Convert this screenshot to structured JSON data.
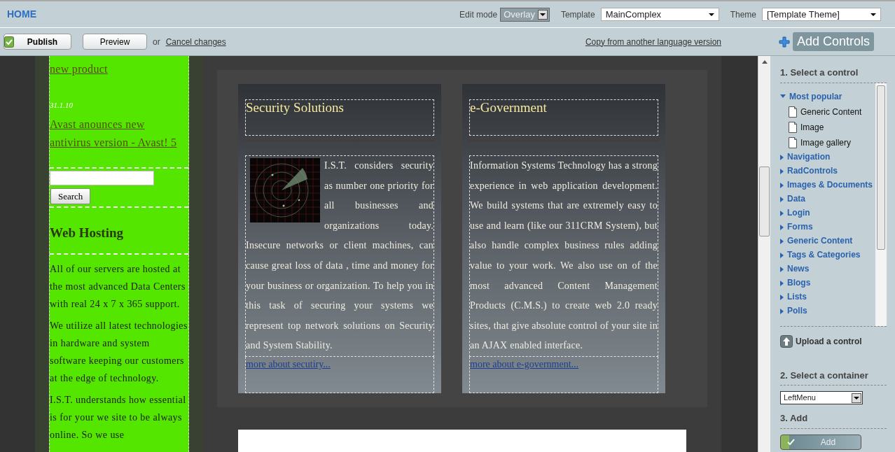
{
  "header": {
    "home": "HOME",
    "edit_mode": {
      "label": "Edit mode",
      "value": "Overlay"
    },
    "template": {
      "label": "Template",
      "value": "MainComplex"
    },
    "theme": {
      "label": "Theme",
      "value": "[Template Theme]"
    }
  },
  "toolbar": {
    "publish": "Publish",
    "preview": "Preview",
    "or": "or",
    "cancel": "Cancel changes",
    "copy": "Copy from another language version",
    "add_controls": "Add Controls"
  },
  "left_column": {
    "link_1": "new product",
    "date": "31.1.10",
    "link_2": "Avast anounces new antivirus version - Avast! 5",
    "search_button": "Search",
    "heading": "Web Hosting",
    "paragraphs": [
      "All of our servers are hosted at the most advanced Data Centers with real 24 x 7 x 365 support.",
      "We utilize all latest technologies in hardware and system software keeping our customers at the edge of technology.",
      "I.S.T. understands how essential is for your we site to be always online. So we use"
    ]
  },
  "cards": [
    {
      "title": "Security Solutions",
      "image": true,
      "text": "I.S.T. considers security as number one priority for all businesses and organizations today. Insecure networks or client machines, can cause great loss of data , time and money for your business or organization. To help you in this task of securing your systems we represent top network solutions on Security and System Stability.",
      "link": "more about secutiry..."
    },
    {
      "title": "e-Government",
      "image": false,
      "text": "Information Systems Technology has a strong experience in web application development. We build systems that are extremely easy to use and learn (like our 311CRM System), but also handle complex business rules adding value to your work. We also use on of the most advanced Content Management Products (C.M.S.) to create web 2.0 ready sites, that give absolute control of your site in an AJAX enabled interface.",
      "link": "more about e-government..."
    }
  ],
  "panel": {
    "step_1": "1. Select a control",
    "tree": [
      {
        "label": "Most popular",
        "expanded": true,
        "children": [
          {
            "label": "Generic Content"
          },
          {
            "label": "Image"
          },
          {
            "label": "Image gallery"
          }
        ]
      },
      {
        "label": "Navigation",
        "expanded": false
      },
      {
        "label": "RadControls",
        "expanded": false
      },
      {
        "label": "Images & Documents",
        "expanded": false
      },
      {
        "label": "Data",
        "expanded": false
      },
      {
        "label": "Login",
        "expanded": false
      },
      {
        "label": "Forms",
        "expanded": false
      },
      {
        "label": "Generic Content",
        "expanded": false
      },
      {
        "label": "Tags & Categories",
        "expanded": false
      },
      {
        "label": "News",
        "expanded": false
      },
      {
        "label": "Blogs",
        "expanded": false
      },
      {
        "label": "Lists",
        "expanded": false
      },
      {
        "label": "Polls",
        "expanded": false
      }
    ],
    "upload": "Upload a control",
    "step_2": "2. Select a container",
    "container": "LeftMenu",
    "step_3": "3. Add",
    "add_button": "Add"
  }
}
